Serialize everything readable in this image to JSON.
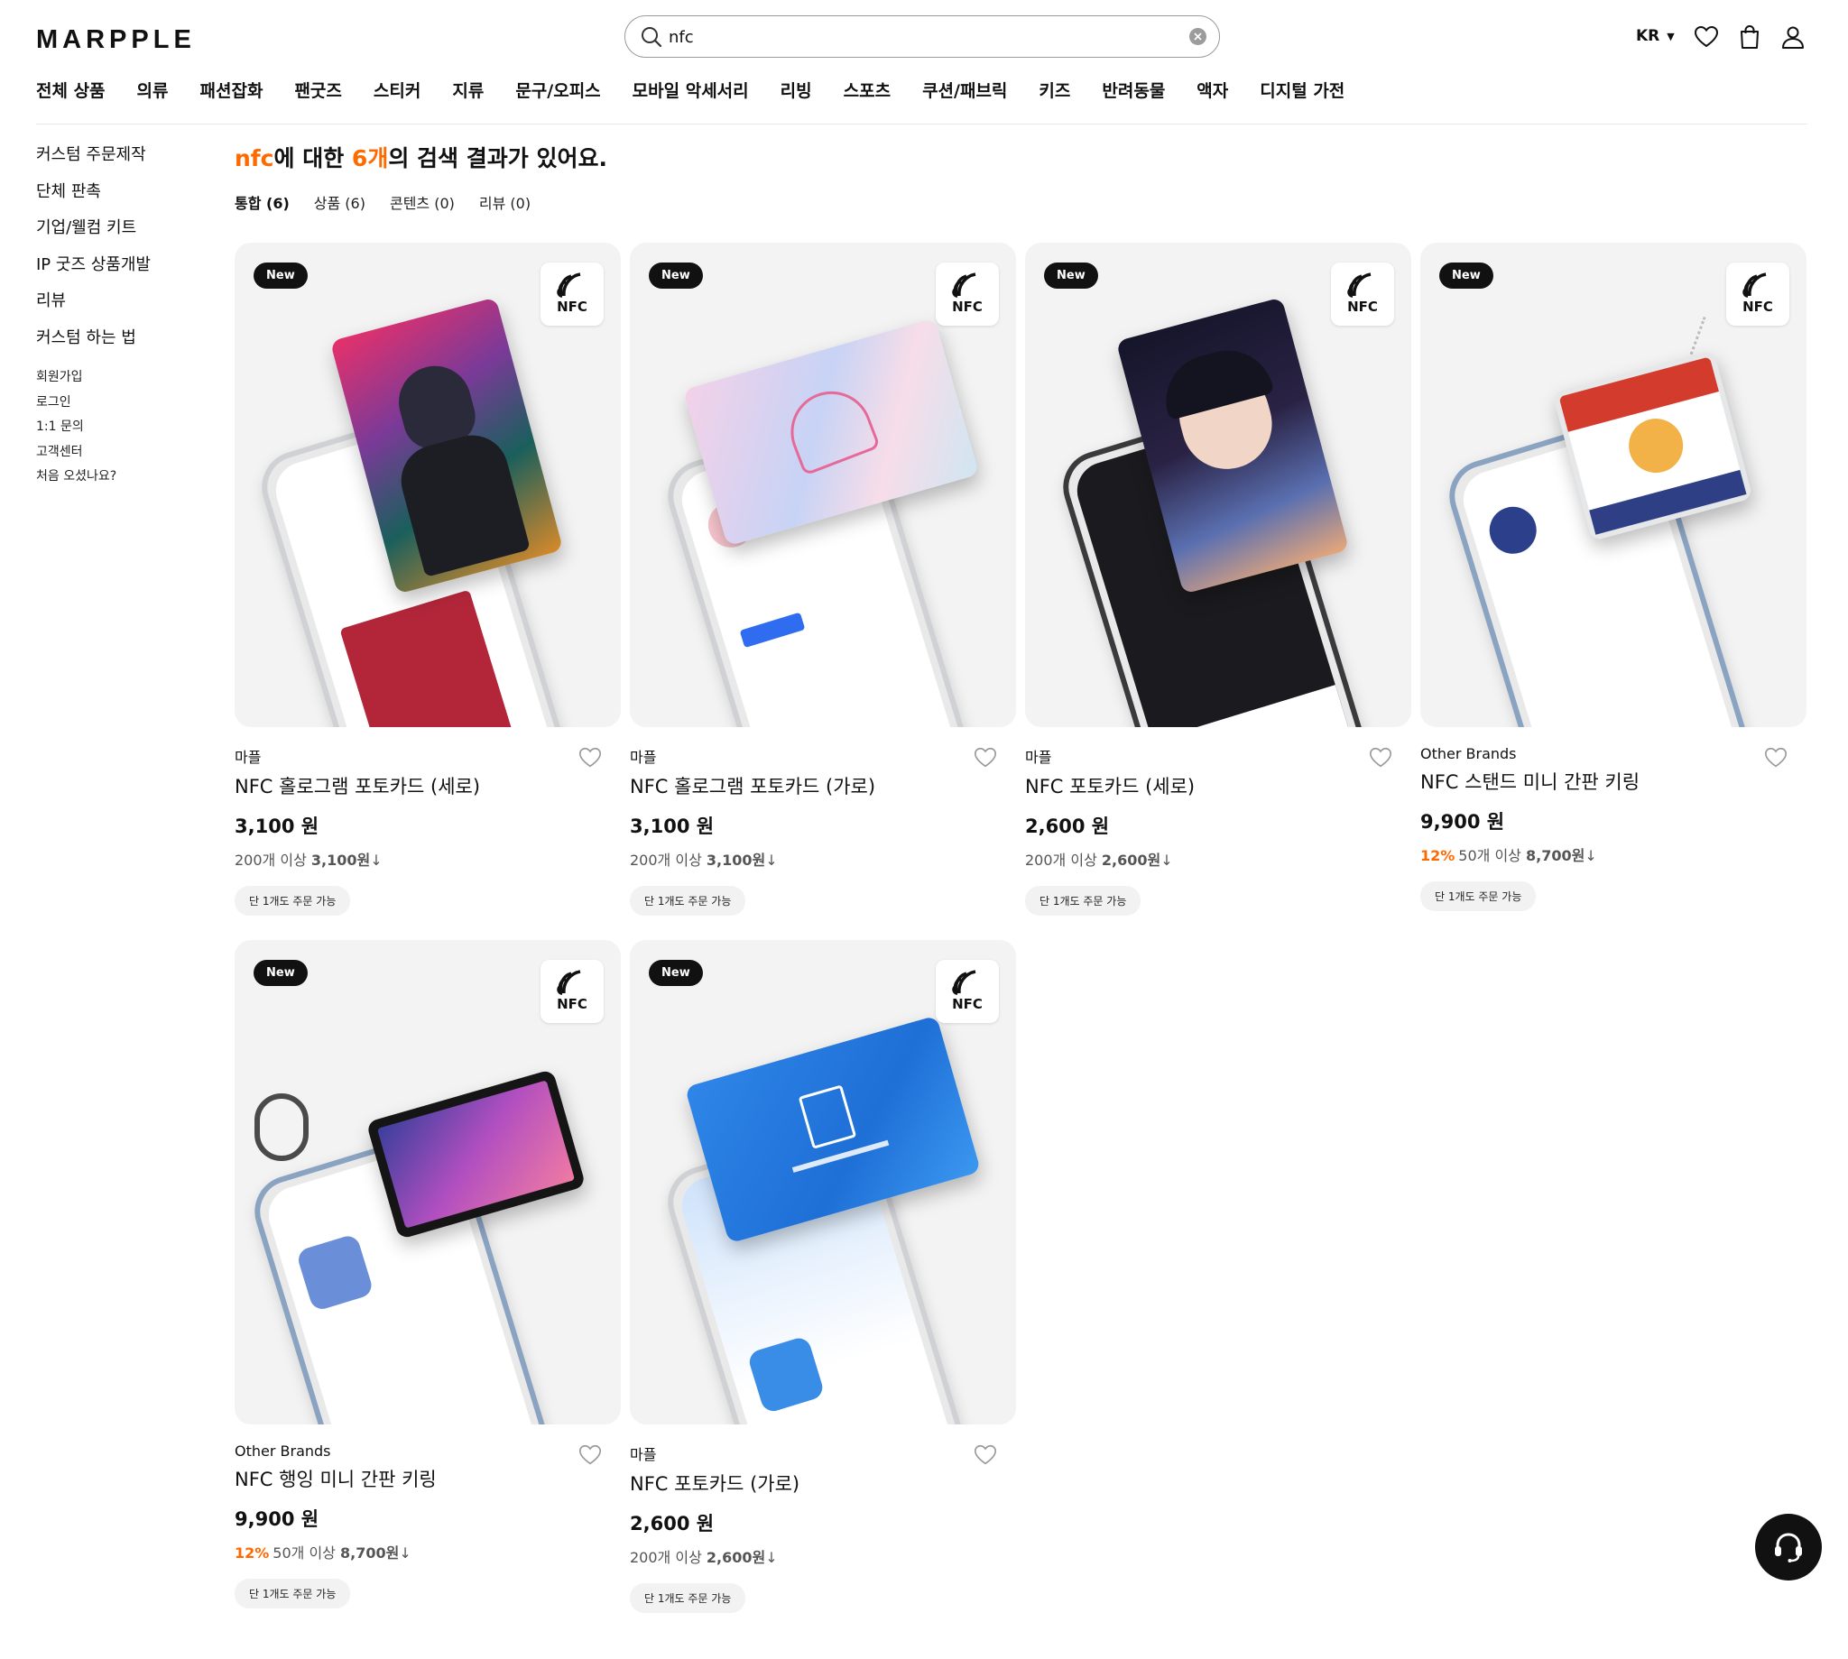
{
  "header": {
    "logo": "MARPPLE",
    "search_value": "nfc",
    "language": "KR",
    "icons": [
      "search-icon",
      "clear-icon",
      "heart-icon",
      "cart-icon",
      "user-icon"
    ]
  },
  "nav": [
    "전체 상품",
    "의류",
    "패션잡화",
    "팬굿즈",
    "스티커",
    "지류",
    "문구/오피스",
    "모바일 악세서리",
    "리빙",
    "스포츠",
    "쿠션/패브릭",
    "키즈",
    "반려동물",
    "액자",
    "디지털 가전"
  ],
  "sidebar": {
    "main": [
      "커스텀 주문제작",
      "단체 판촉",
      "기업/웰컴 키트",
      "IP 굿즈 상품개발",
      "리뷰",
      "커스텀 하는 법"
    ],
    "sub": [
      "회원가입",
      "로그인",
      "1:1 문의",
      "고객센터",
      "처음 오셨나요?"
    ]
  },
  "results": {
    "keyword": "nfc",
    "mid1": "에 대한 ",
    "count": "6개",
    "mid2": "의 검색 결과가 있어요.",
    "tabs": [
      "통합 (6)",
      "상품 (6)",
      "콘텐츠 (0)",
      "리뷰 (0)"
    ]
  },
  "badges": {
    "new": "New",
    "nfc": "NFC"
  },
  "products": [
    {
      "brand": "마플",
      "name": "NFC 홀로그램 포토카드 (세로)",
      "price": "3,100 원",
      "discount": "",
      "bulk_prefix": "200개 이상 ",
      "bulk_price": "3,100원",
      "bulk_arrow": "↓",
      "chip": "단 1개도 주문 가능"
    },
    {
      "brand": "마플",
      "name": "NFC 홀로그램 포토카드 (가로)",
      "price": "3,100 원",
      "discount": "",
      "bulk_prefix": "200개 이상 ",
      "bulk_price": "3,100원",
      "bulk_arrow": "↓",
      "chip": "단 1개도 주문 가능"
    },
    {
      "brand": "마플",
      "name": "NFC 포토카드 (세로)",
      "price": "2,600 원",
      "discount": "",
      "bulk_prefix": "200개 이상 ",
      "bulk_price": "2,600원",
      "bulk_arrow": "↓",
      "chip": "단 1개도 주문 가능"
    },
    {
      "brand": "Other Brands",
      "name": "NFC 스탠드 미니 간판 키링",
      "price": "9,900 원",
      "discount": "12%",
      "bulk_prefix": "50개 이상 ",
      "bulk_price": "8,700원",
      "bulk_arrow": "↓",
      "chip": "단 1개도 주문 가능"
    },
    {
      "brand": "Other Brands",
      "name": "NFC 행잉 미니 간판 키링",
      "price": "9,900 원",
      "discount": "12%",
      "bulk_prefix": "50개 이상 ",
      "bulk_price": "8,700원",
      "bulk_arrow": "↓",
      "chip": "단 1개도 주문 가능"
    },
    {
      "brand": "마플",
      "name": "NFC 포토카드 (가로)",
      "price": "2,600 원",
      "discount": "",
      "bulk_prefix": "200개 이상 ",
      "bulk_price": "2,600원",
      "bulk_arrow": "↓",
      "chip": "단 1개도 주문 가능"
    }
  ],
  "colors": {
    "accent": "#ff6a00",
    "text": "#111111",
    "card_bg": "#f3f3f3"
  }
}
